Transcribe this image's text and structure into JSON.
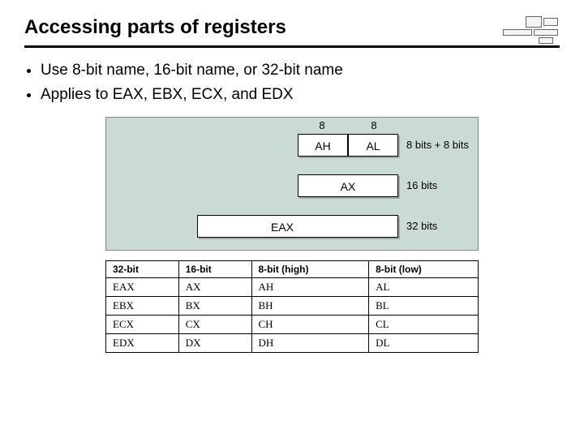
{
  "title": "Accessing parts of registers",
  "bullets": [
    "Use 8-bit name, 16-bit name, or 32-bit name",
    "Applies to EAX, EBX, ECX, and EDX"
  ],
  "diagram": {
    "top_bits_left": "8",
    "top_bits_right": "8",
    "ah": "AH",
    "al": "AL",
    "ax": "AX",
    "eax": "EAX",
    "side_8": "8 bits + 8 bits",
    "side_16": "16 bits",
    "side_32": "32 bits"
  },
  "table": {
    "headers": [
      "32-bit",
      "16-bit",
      "8-bit (high)",
      "8-bit (low)"
    ],
    "rows": [
      [
        "EAX",
        "AX",
        "AH",
        "AL"
      ],
      [
        "EBX",
        "BX",
        "BH",
        "BL"
      ],
      [
        "ECX",
        "CX",
        "CH",
        "CL"
      ],
      [
        "EDX",
        "DX",
        "DH",
        "DL"
      ]
    ]
  }
}
